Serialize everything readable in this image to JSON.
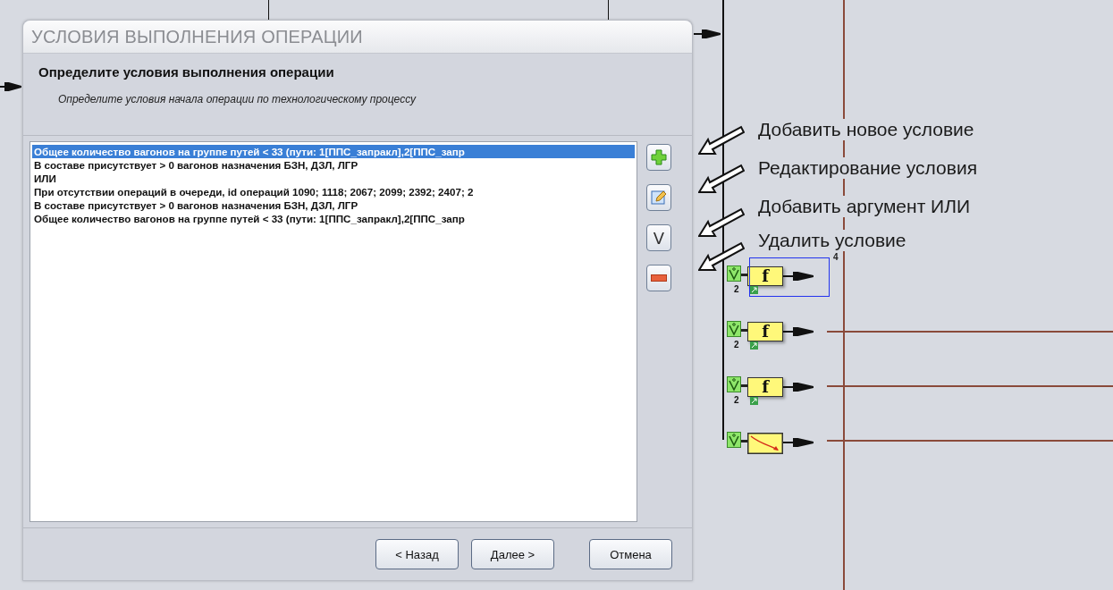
{
  "dialog": {
    "title": "УСЛОВИЯ ВЫПОЛНЕНИЯ ОПЕРАЦИИ",
    "heading": "Определите условия выполнения операции",
    "subtitle": "Определите условия начала операции по технологическому процессу",
    "conditions": [
      {
        "text": "Общее количество вагонов на группе путей < 33 (пути: 1[ППС_запракл],2[ППС_запр",
        "selected": true
      },
      {
        "text": "В составе присутствует > 0 вагонов назначения БЗН, ДЗЛ, ЛГР",
        "selected": false
      },
      {
        "text": "ИЛИ",
        "selected": false
      },
      {
        "text": "При отсутствии операций в очереди, id операций 1090; 1118; 2067; 2099; 2392; 2407; 2",
        "selected": false
      },
      {
        "text": "В составе присутствует > 0 вагонов назначения БЗН, ДЗЛ, ЛГР",
        "selected": false
      },
      {
        "text": "Общее количество вагонов на группе путей < 33 (пути: 1[ППС_запракл],2[ППС_запр",
        "selected": false
      }
    ],
    "tools": [
      {
        "kind": "add"
      },
      {
        "kind": "edit"
      },
      {
        "kind": "or",
        "label": "V"
      },
      {
        "kind": "remove"
      }
    ],
    "buttons": [
      "< Назад",
      "Далее >",
      "Отмена"
    ]
  },
  "annotations": [
    "Добавить новое условие",
    "Редактирование условия",
    "Добавить аргумент ИЛИ",
    "Удалить условие"
  ],
  "canvas": {
    "corner_label": "4",
    "nodes": [
      {
        "kind": "function",
        "label": "f",
        "count": "2",
        "selected": true
      },
      {
        "kind": "function",
        "label": "f",
        "count": "2",
        "selected": false
      },
      {
        "kind": "function",
        "label": "f",
        "count": "2",
        "selected": false
      },
      {
        "kind": "curve",
        "selected": false
      }
    ]
  }
}
